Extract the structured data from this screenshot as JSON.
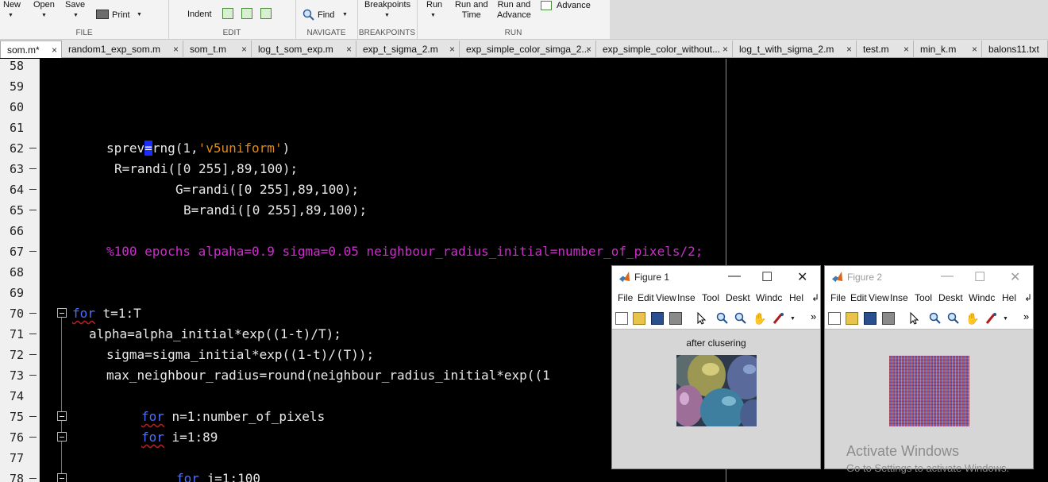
{
  "ribbon": {
    "file": {
      "new_label": "New",
      "open_label": "Open",
      "save_label": "Save",
      "print_label": "Print",
      "group": "FILE"
    },
    "edit": {
      "indent_label": "Indent",
      "group": "EDIT"
    },
    "navigate": {
      "find_label": "Find",
      "group": "NAVIGATE"
    },
    "breakpoints": {
      "label": "Breakpoints",
      "group": "BREAKPOINTS"
    },
    "run": {
      "run_label": "Run",
      "run_time_label": "Run and\nTime",
      "run_advance_label": "Run and\nAdvance",
      "advance_label": "Advance",
      "group": "RUN"
    }
  },
  "tabs": [
    {
      "label": "som.m*",
      "active": true
    },
    {
      "label": "random1_exp_som.m"
    },
    {
      "label": "som_t.m"
    },
    {
      "label": "log_t_som_exp.m"
    },
    {
      "label": "exp_t_sigma_2.m"
    },
    {
      "label": "exp_simple_color_simga_2..."
    },
    {
      "label": "exp_simple_color_without..."
    },
    {
      "label": "log_t_with_sigma_2.m"
    },
    {
      "label": "test.m"
    },
    {
      "label": "min_k.m"
    },
    {
      "label": "balons11.txt"
    }
  ],
  "tab_close": "×",
  "editor": {
    "line_numbers": [
      "58",
      "59",
      "60",
      "61",
      "62",
      "63",
      "64",
      "65",
      "66",
      "67",
      "68",
      "69",
      "70",
      "71",
      "72",
      "73",
      "74",
      "75",
      "76",
      "77",
      "78"
    ],
    "code": {
      "l62a": "sprev",
      "l62caret": "=",
      "l62b": "rng(1,",
      "l62str": "'v5uniform'",
      "l62c": ")",
      "l63": "R=randi([0 255],89,100);",
      "l64": "G=randi([0 255],89,100);",
      "l65": "B=randi([0 255],89,100);",
      "l67": "%100 epochs alpaha=0.9 sigma=0.05 neighbour_radius_initial=number_of_pixels/2;",
      "l70kw": "for",
      "l70": " t=1:T",
      "l71": "alpha=alpha_initial*exp((1-t)/T);",
      "l72": "sigma=sigma_initial*exp((1-t)/(T));",
      "l73": "max_neighbour_radius=round(neighbour_radius_initial*exp((1",
      "l75kw": "for",
      "l75": " n=1:number_of_pixels",
      "l76kw": "for",
      "l76": " i=1:89",
      "l78kw": "for",
      "l78": " j=1:100"
    }
  },
  "figure1": {
    "title": "Figure 1",
    "menu": [
      "File",
      "Edit",
      "View",
      "Inse",
      "Tool",
      "Deskt",
      "Windc",
      "Hel"
    ],
    "plot_title": "after clusering"
  },
  "figure2": {
    "title": "Figure 2",
    "menu": [
      "File",
      "Edit",
      "View",
      "Inse",
      "Tool",
      "Deskt",
      "Windc",
      "Hel"
    ]
  },
  "window_buttons": {
    "min": "—",
    "max": "☐",
    "close": "✕"
  },
  "watermark": {
    "line1": "Activate Windows",
    "line2": "Go to Settings to activate Windows."
  },
  "colors": {
    "keyword": "#4c6cff",
    "string": "#e08a1a",
    "comment": "#d02ad0",
    "background": "#000000"
  }
}
